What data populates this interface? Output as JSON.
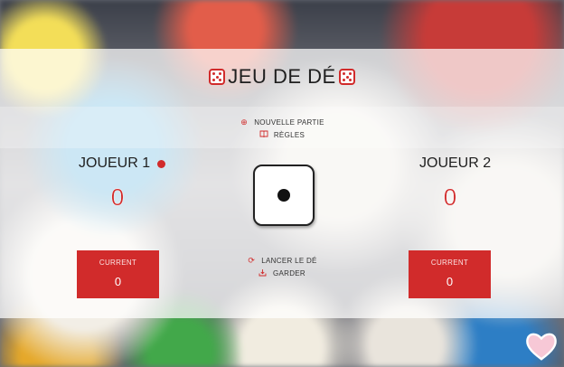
{
  "game": {
    "title": "JEU DE DÉ",
    "new_game": "NOUVELLE PARTIE",
    "rules": "RÈGLES",
    "roll": "LANCER LE DÉ",
    "hold": "GARDER",
    "dice_value": 1
  },
  "players": [
    {
      "name": "JOUEUR 1",
      "score": "0",
      "current_label": "CURRENT",
      "current": "0",
      "active": true
    },
    {
      "name": "JOUEUR 2",
      "score": "0",
      "current_label": "CURRENT",
      "current": "0",
      "active": false
    }
  ],
  "icons": {
    "title": "dice-icon",
    "new_game": "plus-circle-icon",
    "rules": "book-icon",
    "roll": "refresh-icon",
    "hold": "download-icon",
    "corner": "heart-icon"
  },
  "colors": {
    "accent": "#d12b2b",
    "text": "#1f1f1f"
  }
}
